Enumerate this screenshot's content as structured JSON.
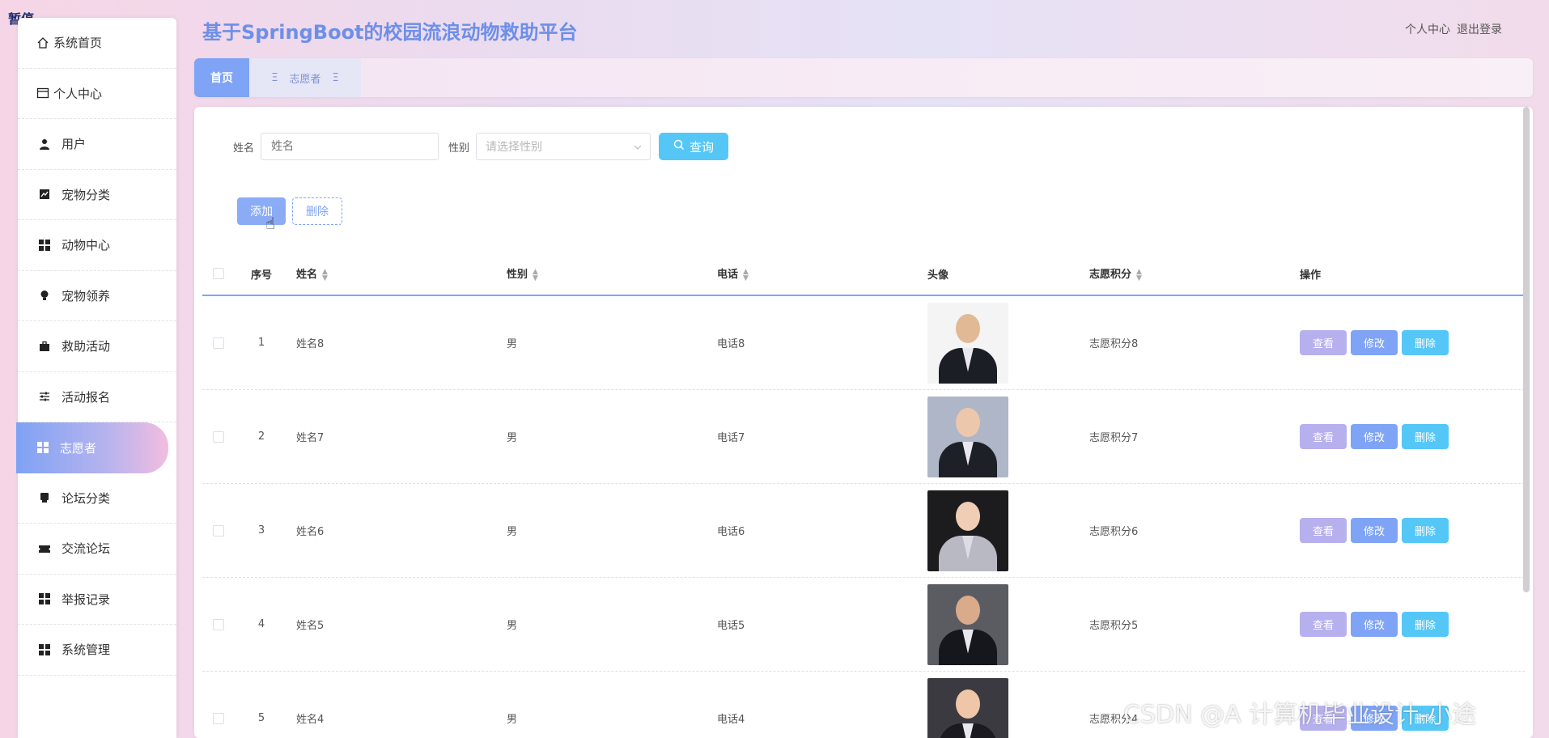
{
  "pause_label": "暂停",
  "app_title": "基于SpringBoot的校园流浪动物救助平台",
  "header_links": {
    "profile": "个人中心",
    "logout": "退出登录"
  },
  "tabs": {
    "home": "首页",
    "current": "志愿者"
  },
  "sidebar": {
    "items": [
      {
        "label": "系统首页",
        "icon": "home-icon"
      },
      {
        "label": "个人中心",
        "icon": "window-icon"
      },
      {
        "label": "用户",
        "icon": "user-icon"
      },
      {
        "label": "宠物分类",
        "icon": "chart-icon"
      },
      {
        "label": "动物中心",
        "icon": "grid-icon"
      },
      {
        "label": "宠物领养",
        "icon": "bulb-icon"
      },
      {
        "label": "救助活动",
        "icon": "briefcase-icon"
      },
      {
        "label": "活动报名",
        "icon": "sliders-icon"
      },
      {
        "label": "志愿者",
        "icon": "grid-icon",
        "active": true
      },
      {
        "label": "论坛分类",
        "icon": "printer-icon"
      },
      {
        "label": "交流论坛",
        "icon": "ticket-icon"
      },
      {
        "label": "举报记录",
        "icon": "grid-icon"
      },
      {
        "label": "系统管理",
        "icon": "grid-icon"
      }
    ]
  },
  "search": {
    "name_label": "姓名",
    "name_placeholder": "姓名",
    "gender_label": "性别",
    "gender_placeholder": "请选择性别",
    "query_button": "查询"
  },
  "actions": {
    "add": "添加",
    "delete": "删除"
  },
  "table": {
    "columns": {
      "no": "序号",
      "name": "姓名",
      "gender": "性别",
      "phone": "电话",
      "avatar": "头像",
      "points": "志愿积分",
      "ops": "操作"
    },
    "op_labels": {
      "view": "查看",
      "edit": "修改",
      "delete": "删除"
    },
    "rows": [
      {
        "no": "1",
        "name": "姓名8",
        "gender": "男",
        "phone": "电话8",
        "points": "志愿积分8"
      },
      {
        "no": "2",
        "name": "姓名7",
        "gender": "男",
        "phone": "电话7",
        "points": "志愿积分7"
      },
      {
        "no": "3",
        "name": "姓名6",
        "gender": "男",
        "phone": "电话6",
        "points": "志愿积分6"
      },
      {
        "no": "4",
        "name": "姓名5",
        "gender": "男",
        "phone": "电话5",
        "points": "志愿积分5"
      },
      {
        "no": "5",
        "name": "姓名4",
        "gender": "男",
        "phone": "电话4",
        "points": "志愿积分4"
      }
    ]
  },
  "watermark": "CSDN @A 计算机毕业设计-小途",
  "colors": {
    "accent": "#7fa4f5",
    "title": "#6d8fe8",
    "query": "#55c7f7",
    "view": "#b7b0ee"
  }
}
